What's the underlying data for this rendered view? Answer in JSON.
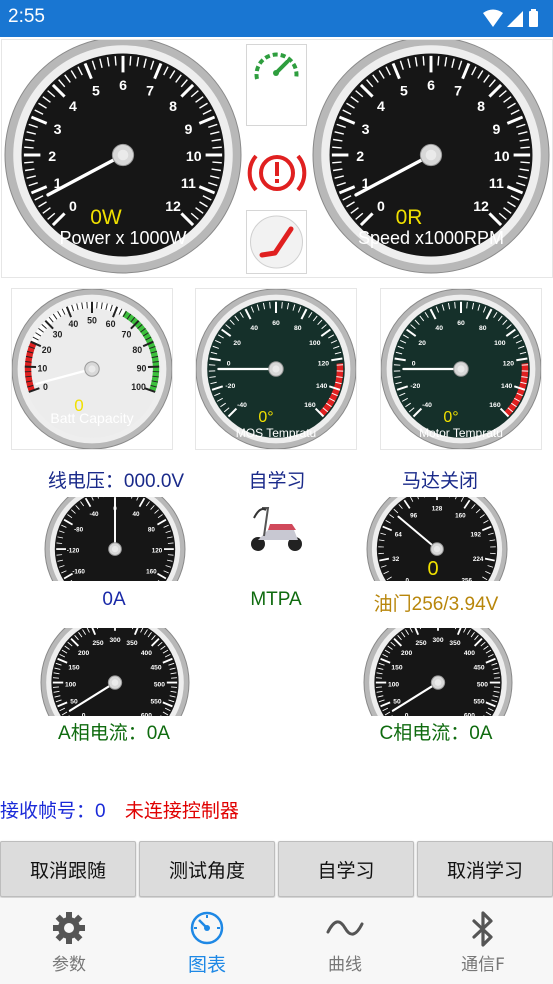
{
  "status_bar": {
    "time": "2:55"
  },
  "gauges": {
    "power": {
      "value_text": "0W",
      "caption": "Power x 1000W",
      "ticks": [
        "0",
        "1",
        "2",
        "3",
        "4",
        "5",
        "6",
        "7",
        "8",
        "9",
        "10",
        "11",
        "12"
      ]
    },
    "speed": {
      "value_text": "0R",
      "caption": "Speed x1000RPM",
      "ticks": [
        "0",
        "1",
        "2",
        "3",
        "4",
        "5",
        "6",
        "7",
        "8",
        "9",
        "10",
        "11",
        "12"
      ]
    },
    "battery": {
      "value_text": "0",
      "caption": "Batt Capacity",
      "ticks": [
        "0",
        "10",
        "20",
        "30",
        "40",
        "50",
        "60",
        "70",
        "80",
        "90",
        "100"
      ]
    },
    "mos_temp": {
      "value_text": "0°",
      "caption": "MOS Tempratu",
      "ticks": [
        "-40",
        "-20",
        "0",
        "20",
        "40",
        "60",
        "80",
        "100",
        "120",
        "140",
        "160"
      ]
    },
    "motor_temp": {
      "value_text": "0°",
      "caption": "Motor Tempratu",
      "ticks": [
        "-40",
        "-20",
        "0",
        "20",
        "40",
        "60",
        "80",
        "100",
        "120",
        "140",
        "160"
      ]
    },
    "current": {
      "ticks": [
        "-240",
        "-200",
        "-160",
        "-120",
        "-80",
        "-40",
        "0",
        "40",
        "80",
        "120",
        "160",
        "200",
        "240"
      ]
    },
    "throttle": {
      "value_text": "0",
      "ticks": [
        "0",
        "32",
        "64",
        "96",
        "128",
        "160",
        "192",
        "224",
        "256"
      ]
    },
    "phase_a": {
      "ticks": [
        "0",
        "50",
        "100",
        "150",
        "200",
        "250",
        "300",
        "350",
        "400",
        "450",
        "500",
        "550",
        "600"
      ]
    },
    "phase_c": {
      "ticks": [
        "0",
        "50",
        "100",
        "150",
        "200",
        "250",
        "300",
        "350",
        "400",
        "450",
        "500",
        "550",
        "600"
      ]
    }
  },
  "labels": {
    "line_voltage": "线电压：000.0V",
    "self_learn": "自学习",
    "motor_state": "马达关闭",
    "current_value": "0A",
    "mode": "MTPA",
    "throttle": "油门256/3.94V",
    "phase_a": "A相电流：0A",
    "phase_c": "C相电流：0A",
    "frame_label": "接收帧号：",
    "frame_value": "0",
    "connection_status": "未连接控制器"
  },
  "buttons": {
    "cancel_follow": "取消跟随",
    "test_angle": "测试角度",
    "self_learn": "自学习",
    "cancel_learn": "取消学习"
  },
  "nav": {
    "items": [
      {
        "label": "参数",
        "icon": "gear-icon"
      },
      {
        "label": "图表",
        "icon": "gauge-icon"
      },
      {
        "label": "曲线",
        "icon": "wave-icon"
      },
      {
        "label": "通信F",
        "icon": "bluetooth-icon"
      }
    ],
    "active_index": 1
  },
  "colors": {
    "status_bar": "#1976d2",
    "active_nav": "#1e88e5",
    "warning_red": "#e02020",
    "cruise_green": "#2e9e3e"
  }
}
